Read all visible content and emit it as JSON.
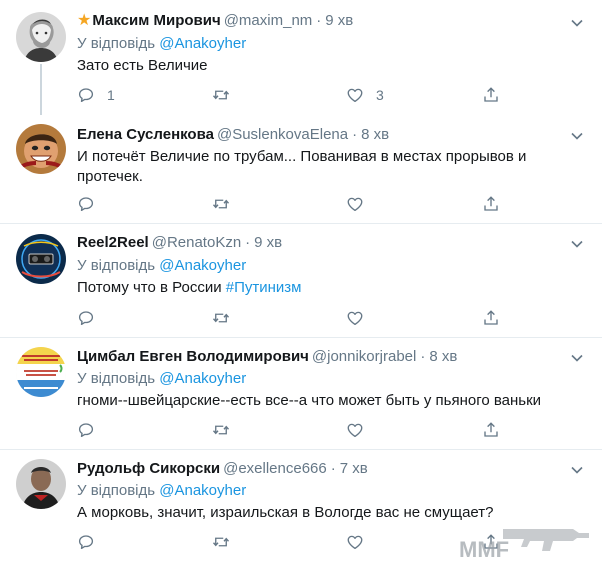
{
  "tweets": [
    {
      "starred": true,
      "name": "Максим Мирович",
      "handle": "@maxim_nm",
      "time": "9 хв",
      "reply_prefix": "У відповідь",
      "reply_mention": "@Anakoyher",
      "text": "Зато есть Величие",
      "reply_count": "1",
      "like_count": "3"
    },
    {
      "name": "Елена Сусленкова",
      "handle": "@SuslenkovaElena",
      "time": "8 хв",
      "text": "И потечёт Величие по трубам... Пованивая в местах прорывов и протечек."
    },
    {
      "name": "Reel2Reel",
      "handle": "@RenatoKzn",
      "time": "9 хв",
      "reply_prefix": "У відповідь",
      "reply_mention": "@Anakoyher",
      "text_before": "Потому что в России ",
      "hashtag": "#Путинизм"
    },
    {
      "name": "Цимбал Евген Володимирович",
      "handle": "@jonnikorjrabel",
      "time": "8 хв",
      "reply_prefix": "У відповідь",
      "reply_mention": "@Anakoyher",
      "text": "гноми--швейцарские--есть все--а что может быть у пьяного ваньки"
    },
    {
      "name": "Рудольф Сикорски",
      "handle": "@exellence666",
      "time": "7 хв",
      "reply_prefix": "У відповідь",
      "reply_mention": "@Anakoyher",
      "text": "А морковь, значит, израильская в Вологде вас не смущает?"
    }
  ],
  "icons": {
    "reply": "reply-icon",
    "retweet": "retweet-icon",
    "like": "heart-icon",
    "share": "share-icon",
    "menu": "chevron-down-icon"
  },
  "colors": {
    "link": "#1b95e0",
    "muted": "#657786",
    "star": "#f5a623",
    "divider": "#e6ecf0"
  },
  "watermark": {
    "text": "MMF"
  }
}
